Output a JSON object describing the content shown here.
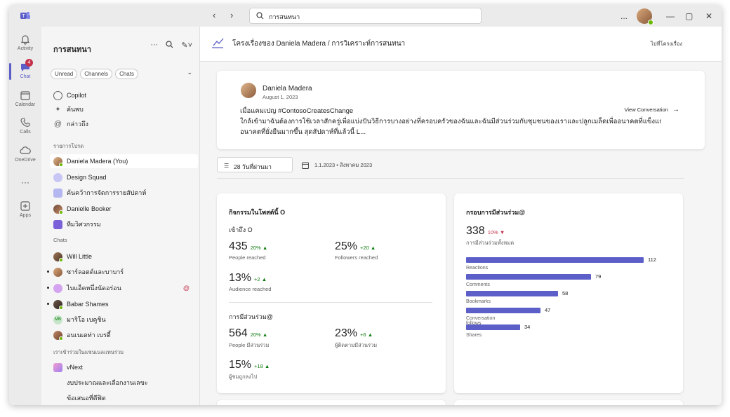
{
  "titlebar": {
    "search_value": "การสนทนา",
    "more_label": "...",
    "minimize": "—",
    "maximize": "▢",
    "close": "✕"
  },
  "rail": [
    {
      "label": "Activity",
      "icon": "bell-icon"
    },
    {
      "label": "Chat",
      "icon": "chat-icon",
      "badge": "4"
    },
    {
      "label": "Calendar",
      "icon": "calendar-icon"
    },
    {
      "label": "Calls",
      "icon": "phone-icon"
    },
    {
      "label": "OneDrive",
      "icon": "cloud-icon"
    },
    {
      "label": "",
      "icon": "more-icon"
    },
    {
      "label": "Apps",
      "icon": "apps-icon"
    }
  ],
  "sidebar": {
    "title": "การสนทนา",
    "chips": [
      "Unread",
      "Channels",
      "Chats"
    ],
    "top_items": [
      {
        "label": "Copilot",
        "icon": "copilot-icon"
      },
      {
        "label": "ค้นพบ",
        "icon": "sparkle-icon"
      },
      {
        "label": "กล่าวถึง",
        "icon": "mention-icon"
      }
    ],
    "favorites_label": "รายการโปรด",
    "favorites": [
      {
        "label": "Daniela Madera (You)",
        "selected": true
      },
      {
        "label": "Design Squad"
      },
      {
        "label": "ค้นคว้าการจัดการรายสัปดาห์"
      },
      {
        "label": "Danielle Booker"
      },
      {
        "label": "ทีมวิศวกรรม"
      }
    ],
    "chats_label": "Chats",
    "chats": [
      {
        "label": "Will Little"
      },
      {
        "label": "ซาร์ลอตต์และบาบาร์",
        "unread": true
      },
      {
        "label": "ไบแอ็คหนึ่งนัดอร่อน",
        "unread": true,
        "mention": "@"
      },
      {
        "label": "Babar Shames",
        "unread": true
      },
      {
        "label": "มาริโอ เบคูชิน"
      },
      {
        "label": "อนเนเดท่า เบรดี้"
      }
    ],
    "teams_label": "เราเข้าร่วมในแชนเนลแทนร่วม",
    "teams": [
      {
        "label": "vNext"
      },
      {
        "label": "งบประมาณและเลือกงานเลขะ"
      },
      {
        "label": "ข้อเสนอที่ดีฟิต"
      }
    ]
  },
  "main": {
    "title": "โครงเรื่องของ Daniela Madera / การวิเคราะห์การสนทนา",
    "right_link": "ไปที่โครงเรื่อง",
    "post": {
      "author": "Daniela Madera",
      "date": "August 1, 2023",
      "view_conversation": "View Conversation",
      "lines": [
        "เมื่อแคมเปญ #ContosoCreatesChange",
        "ใกล้เข้ามาฉันต้องการใช้เวลาสักครู่เพื่อแบ่งปันวิธีการบางอย่างที่ครอบครัวของฉันและฉันมีส่วนร่วมกับชุมชนของเราและปลูกเมล็ดเพื่ออนาคตที่แข็งแกร่งขึ้น",
        "อนาคตที่ยั่งยืนมากขึ้น สุดสัปดาห์ที่แล้วนี้                                                                    L..."
      ]
    },
    "filter": {
      "label": "28 วันที่ผ่านมา",
      "date_range": "1.1.2023 • สิงหาคม 2023"
    },
    "activity_card": {
      "title": "กิจกรรมในโพสต์นี้ O",
      "reach_title": "เข้าถึง O",
      "reach_metrics": [
        {
          "value": "435",
          "delta": "20%",
          "label": "People reached"
        },
        {
          "value": "25%",
          "delta": "+20",
          "label": "Followers reached"
        },
        {
          "value": "13%",
          "delta": "+2",
          "label": "Audience reached"
        }
      ],
      "engagement_title": "การมีส่วนร่วม@",
      "engagement_metrics": [
        {
          "value": "564",
          "delta": "20%",
          "label": "People มีส่วนร่วม"
        },
        {
          "value": "23%",
          "delta": "+6",
          "label": "ผู้ติดตามมีส่วนร่วม"
        },
        {
          "value": "15%",
          "delta": "+18",
          "label": "ผู้ชมถูกลงไป"
        }
      ]
    },
    "engagement_card": {
      "title": "กรอบการมีส่วนร่วม@",
      "total": "338",
      "total_delta": "10%",
      "total_label": "การมีส่วนร่วมทั้งหมด",
      "max": 112,
      "bars": [
        {
          "label": "Reactions",
          "value": 112
        },
        {
          "label": "Comments",
          "value": 79
        },
        {
          "label": "Bookmarks",
          "value": 58
        },
        {
          "label": "Conversation follows",
          "value": 47
        },
        {
          "label": "Shares",
          "value": 34
        }
      ]
    }
  },
  "colors": {
    "accent": "#5b5fc7",
    "positive": "#107c10",
    "negative": "#c4314b",
    "presence": "#6bb700"
  }
}
